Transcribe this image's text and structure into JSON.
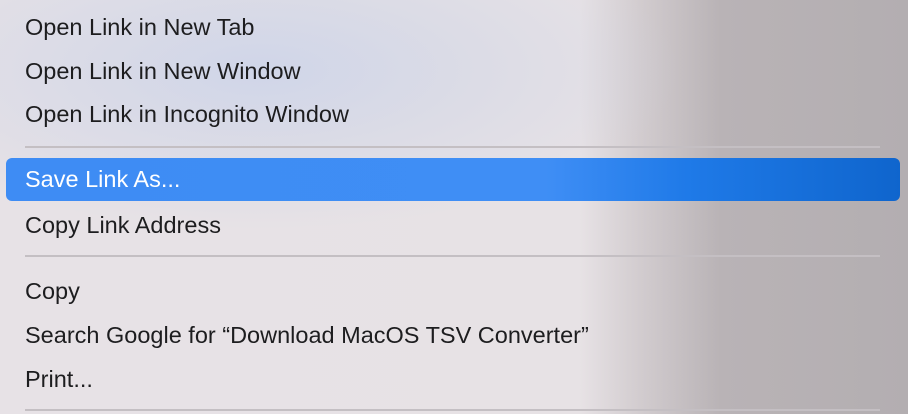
{
  "context_menu": {
    "groups": [
      {
        "items": [
          {
            "label": "Open Link in New Tab"
          },
          {
            "label": "Open Link in New Window"
          },
          {
            "label": "Open Link in Incognito Window"
          }
        ]
      },
      {
        "items": [
          {
            "label": "Save Link As...",
            "highlighted": true
          },
          {
            "label": "Copy Link Address"
          }
        ]
      },
      {
        "items": [
          {
            "label": "Copy"
          },
          {
            "label": "Search Google for “Download MacOS TSV Converter”"
          },
          {
            "label": "Print..."
          }
        ]
      }
    ],
    "highlight_color": "#3f8ef5"
  }
}
